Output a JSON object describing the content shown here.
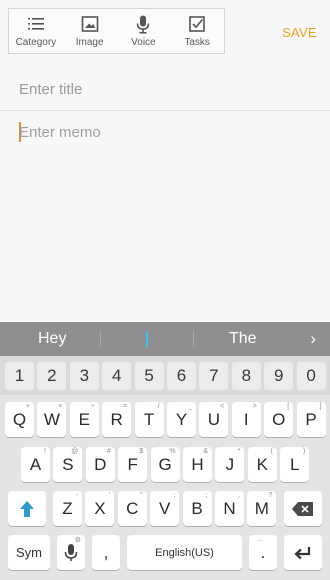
{
  "toolbar": {
    "items": [
      {
        "label": "Category",
        "icon": "list-icon"
      },
      {
        "label": "Image",
        "icon": "image-icon"
      },
      {
        "label": "Voice",
        "icon": "microphone-icon"
      },
      {
        "label": "Tasks",
        "icon": "checkbox-icon"
      }
    ]
  },
  "actions": {
    "save": "SAVE"
  },
  "editor": {
    "title_placeholder": "Enter title",
    "memo_placeholder": "Enter memo"
  },
  "suggestions": [
    "Hey",
    "",
    "The"
  ],
  "keyboard": {
    "numbers": [
      "1",
      "2",
      "3",
      "4",
      "5",
      "6",
      "7",
      "8",
      "9",
      "0"
    ],
    "row1": [
      "Q",
      "W",
      "E",
      "R",
      "T",
      "Y",
      "U",
      "I",
      "O",
      "P"
    ],
    "row1_sub": [
      "+",
      "×",
      "÷",
      "=",
      "/",
      "_",
      "<",
      ">",
      "[",
      "]"
    ],
    "row2": [
      "A",
      "S",
      "D",
      "F",
      "G",
      "H",
      "J",
      "K",
      "L"
    ],
    "row2_sub": [
      "!",
      "@",
      "#",
      "$",
      "%",
      "&",
      "*",
      "(",
      ")"
    ],
    "row3": [
      "Z",
      "X",
      "C",
      "V",
      "B",
      "N",
      "M"
    ],
    "row3_sub": [
      "-",
      "'",
      "\"",
      ":",
      ";",
      ",",
      "?"
    ],
    "sym": "Sym",
    "comma": ",",
    "space": "English(US)",
    "period": ".",
    "period_sub": "...",
    "comma_sub": ""
  },
  "colors": {
    "accent": "#f0a020",
    "shift": "#2e9ad0",
    "suggestion_bar": "#8f8f8f"
  }
}
